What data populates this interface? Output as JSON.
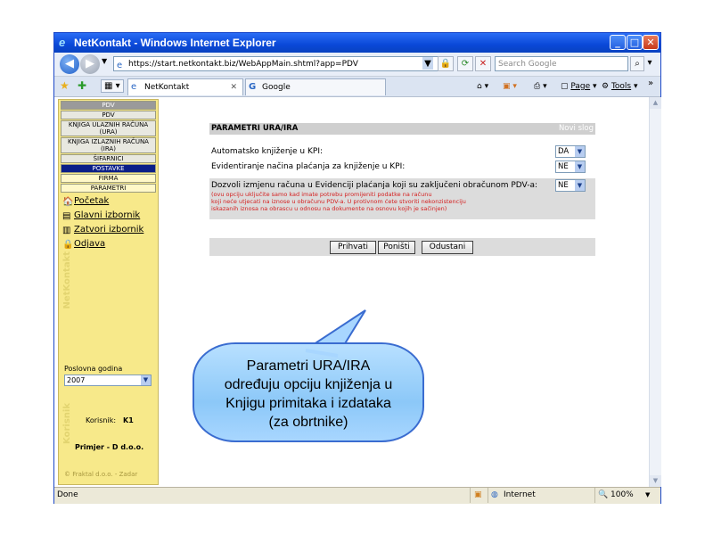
{
  "browser": {
    "title": "NetKontakt - Windows Internet Explorer",
    "url": "https://start.netkontakt.biz/WebAppMain.shtml?app=PDV",
    "search_placeholder": "Search Google",
    "tabs": [
      {
        "label": "NetKontakt"
      },
      {
        "label": "Google"
      }
    ],
    "commands": {
      "page": "Page",
      "tools": "Tools"
    },
    "status_left": "Done",
    "status_zone": "Internet",
    "zoom": "100%"
  },
  "sidebar": {
    "menu": [
      {
        "label": "PDV"
      },
      {
        "label": "PDV"
      },
      {
        "label": "KNJIGA ULAZNIH RAČUNA (URA)"
      },
      {
        "label": "KNJIGA IZLAZNIH RAČUNA (IRA)"
      },
      {
        "label": "ŠIFARNICI"
      },
      {
        "label": "POSTAVKE"
      },
      {
        "label": "FIRMA"
      },
      {
        "label": "PARAMETRI"
      }
    ],
    "links": [
      {
        "label": "Početak",
        "icon": "home-icon"
      },
      {
        "label": "Glavni izbornik",
        "icon": "menu-icon"
      },
      {
        "label": "Zatvori izbornik",
        "icon": "close-menu-icon"
      },
      {
        "label": "Odjava",
        "icon": "lock-icon"
      }
    ],
    "watermark_top": "NetKontakt",
    "year_label": "Poslovna godina",
    "year_value": "2007",
    "user_label": "Korisnik:",
    "user_value": "K1",
    "company": "Primjer - D d.o.o.",
    "watermark_bottom": "Korisnik",
    "footer": "© Fraktal d.o.o. - Zadar"
  },
  "panel": {
    "title": "PARAMETRI URA/IRA",
    "new_record": "Novi slog",
    "fields": [
      {
        "label": "Automatsko knjiženje u KPI:",
        "value": "DA"
      },
      {
        "label": "Evidentiranje načina plaćanja za knjiženje u KPI:",
        "value": "NE"
      },
      {
        "label": "Dozvoli izmjenu računa u Evidenciji plaćanja koji su zaključeni obračunom PDV-a:",
        "value": "NE"
      }
    ],
    "note_lines": [
      "(ovu opciju uključite samo kad imate potrebu promijeniti podatke na računu",
      "koji neće utjecati na iznose u obračunu PDV-a. U protivnom ćete stvoriti nekonzistenciju",
      "iskazanih iznosa na obrascu u odnosu na dokumente na osnovu kojih je sačinjen)"
    ],
    "buttons": {
      "accept": "Prihvati",
      "reset": "Poništi",
      "cancel": "Odustani"
    }
  },
  "callout": {
    "lines": [
      "Parametri URA/IRA",
      "određuju opciju knjiženja u",
      "Knjigu primitaka i izdataka",
      "(za obrtnike)"
    ]
  },
  "colors": {
    "sidebar_bg": "#f7e98a",
    "menu_highlight": "#0a1e88",
    "note_red": "#d42020",
    "bubble_border": "#3a6cd0"
  }
}
